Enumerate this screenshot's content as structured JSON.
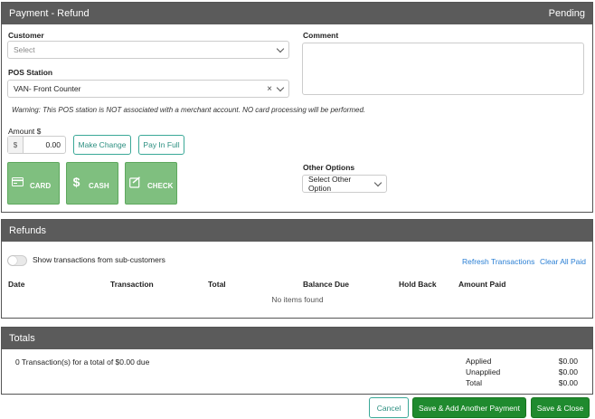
{
  "payment": {
    "title": "Payment - Refund",
    "status": "Pending",
    "customer_label": "Customer",
    "customer_placeholder": "Select",
    "pos_label": "POS Station",
    "pos_value": "VAN- Front Counter",
    "clear_symbol": "×",
    "comment_label": "Comment",
    "warning": "Warning: This POS station is NOT associated with a merchant account. NO card processing will be performed.",
    "amount_label": "Amount $",
    "currency_symbol": "$",
    "amount_value": "0.00",
    "make_change_label": "Make Change",
    "pay_in_full_label": "Pay In Full",
    "tiles": [
      {
        "label": "CARD",
        "icon": "credit-card-icon"
      },
      {
        "label": "CASH",
        "icon": "dollar-icon"
      },
      {
        "label": "CHECK",
        "icon": "check-edit-icon"
      }
    ],
    "other_options_label": "Other Options",
    "other_options_value": "Select Other Option"
  },
  "refunds": {
    "title": "Refunds",
    "toggle_label": "Show transactions from sub-customers",
    "refresh_label": "Refresh Transactions",
    "clear_all_label": "Clear All Paid",
    "columns": [
      "Date",
      "Transaction",
      "Total",
      "Balance Due",
      "Hold Back",
      "Amount Paid"
    ],
    "empty_message": "No items found"
  },
  "totals": {
    "title": "Totals",
    "summary": "0 Transaction(s) for a total of $0.00 due",
    "rows": [
      {
        "label": "Applied",
        "value": "$0.00"
      },
      {
        "label": "Unapplied",
        "value": "$0.00"
      },
      {
        "label": "Total",
        "value": "$0.00"
      }
    ]
  },
  "footer": {
    "cancel_label": "Cancel",
    "save_add_label": "Save & Add Another Payment",
    "save_close_label": "Save & Close"
  },
  "colors": {
    "header_bg": "#5b5b5b",
    "tile_green": "#7fbf7f",
    "primary_green": "#1f8a2e",
    "teal_outline": "#3aa897",
    "link_blue": "#2a7fd4"
  }
}
